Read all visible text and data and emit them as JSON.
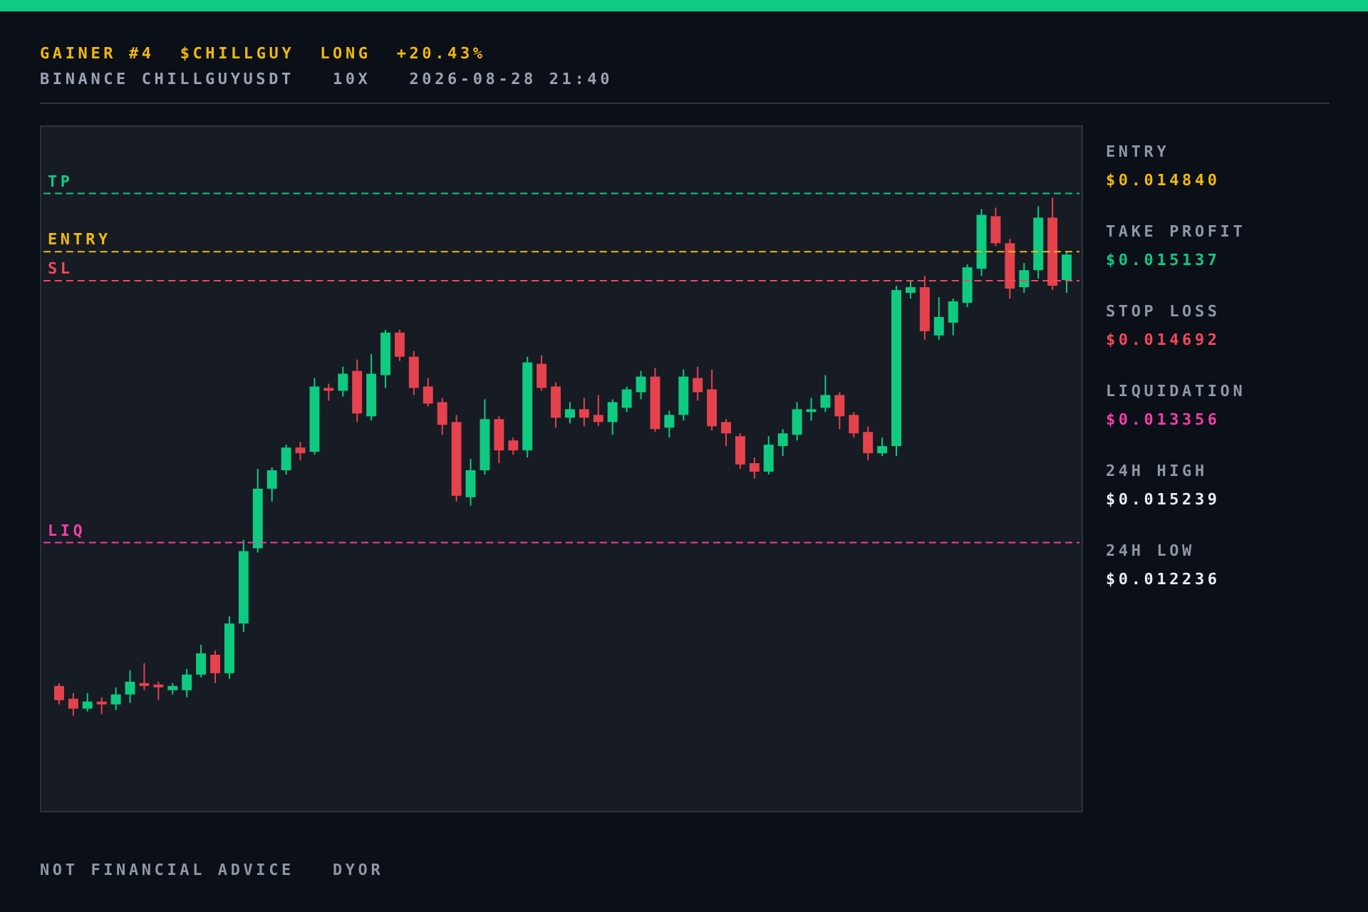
{
  "header": {
    "title_parts": [
      "GAINER #4",
      "$CHILLGUY",
      "LONG",
      "+20.43%"
    ],
    "subtitle_parts": [
      "BINANCE CHILLGUYUSDT",
      "10X",
      "2026-08-28 21:40"
    ]
  },
  "chart": {
    "levels": [
      {
        "kind": "tp",
        "label": "TP",
        "color": "#0ecb81"
      },
      {
        "kind": "entry",
        "label": "ENTRY",
        "color": "#f0b90b"
      },
      {
        "kind": "sl",
        "label": "SL",
        "color": "#f6465d"
      },
      {
        "kind": "liq",
        "label": "LIQ",
        "color": "#f23fa6"
      }
    ]
  },
  "stats": [
    {
      "kind": "entry",
      "label": "ENTRY",
      "value": "$0.014840",
      "color": "#f0b90b"
    },
    {
      "kind": "tp",
      "label": "TAKE PROFIT",
      "value": "$0.015137",
      "color": "#0ecb81"
    },
    {
      "kind": "sl",
      "label": "STOP LOSS",
      "value": "$0.014692",
      "color": "#f6465d"
    },
    {
      "kind": "liq",
      "label": "LIQUIDATION",
      "value": "$0.013356",
      "color": "#f23fa6"
    },
    {
      "label": "24H HIGH",
      "value": "$0.015239",
      "color": "#eaecef"
    },
    {
      "label": "24H LOW",
      "value": "$0.012236",
      "color": "#eaecef"
    }
  ],
  "footer": [
    "NOT FINANCIAL ADVICE",
    "DYOR"
  ]
}
